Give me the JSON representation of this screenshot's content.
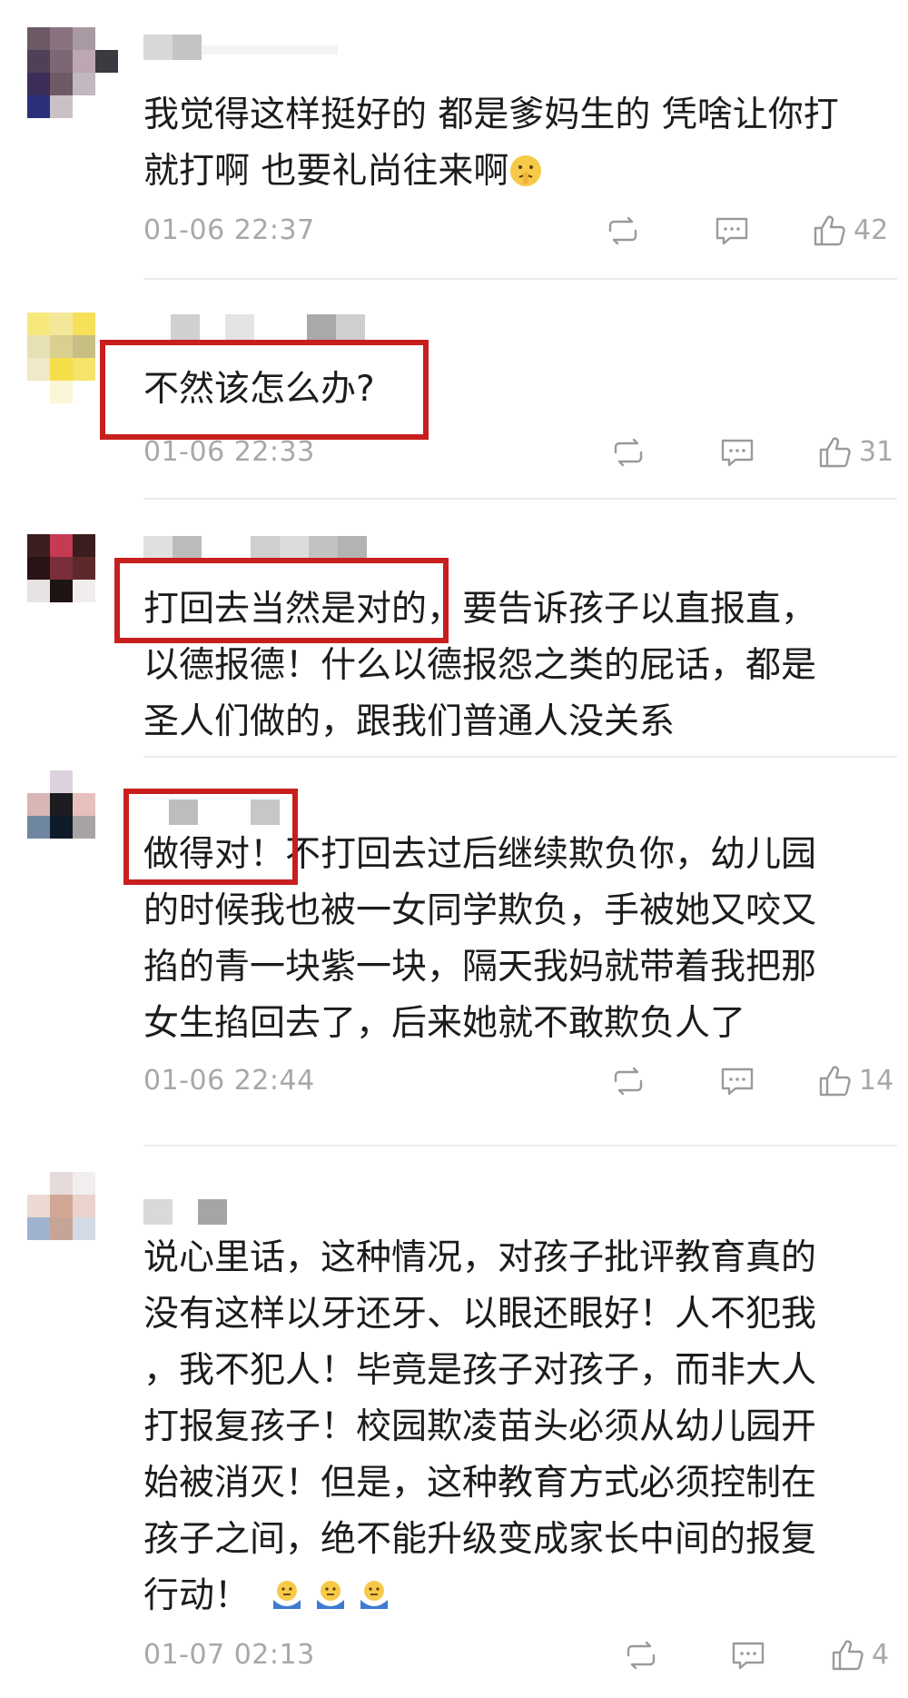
{
  "comments": [
    {
      "lines": [
        "我觉得这样挺好的 都是爹妈生的 凭啥让你打",
        "就打啊 也要礼尚往来啊"
      ],
      "time": "01-06 22:37",
      "likes": "42"
    },
    {
      "lines": [
        "不然该怎么办?"
      ],
      "time": "01-06 22:33",
      "likes": "31"
    },
    {
      "lines": [
        "打回去当然是对的，要告诉孩子以直报直，",
        "以德报德！什么以德报怨之类的屁话，都是",
        "圣人们做的，跟我们普通人没关系"
      ]
    },
    {
      "lines": [
        "做得对！不打回去过后继续欺负你，幼儿园",
        "的时候我也被一女同学欺负，手被她又咬又",
        "掐的青一块紫一块，隔天我妈就带着我把那",
        "女生掐回去了，后来她就不敢欺负人了"
      ],
      "time": "01-06 22:44",
      "likes": "14"
    },
    {
      "lines": [
        "说心里话，这种情况，对孩子批评教育真的",
        "没有这样以牙还牙、以眼还眼好！人不犯我",
        "，我不犯人！毕竟是孩子对孩子，而非大人",
        "打报复孩子！校园欺凌苗头必须从幼儿园开",
        "始被消灭！但是，这种教育方式必须控制在",
        "孩子之间，绝不能升级变成家长中间的报复",
        "行动！"
      ],
      "time": "01-07 02:13",
      "likes": "4"
    }
  ],
  "icons": {
    "repost": "repost-icon",
    "comment": "comment-icon",
    "like": "thumbs-up-icon",
    "emoji_thinking": "shush-face-emoji",
    "emoji_shrug": "shrug-emoji"
  },
  "colors": {
    "highlight_box": "#c81e1e",
    "meta_text": "#a8a8a8",
    "body_text": "#1c1c1c"
  }
}
